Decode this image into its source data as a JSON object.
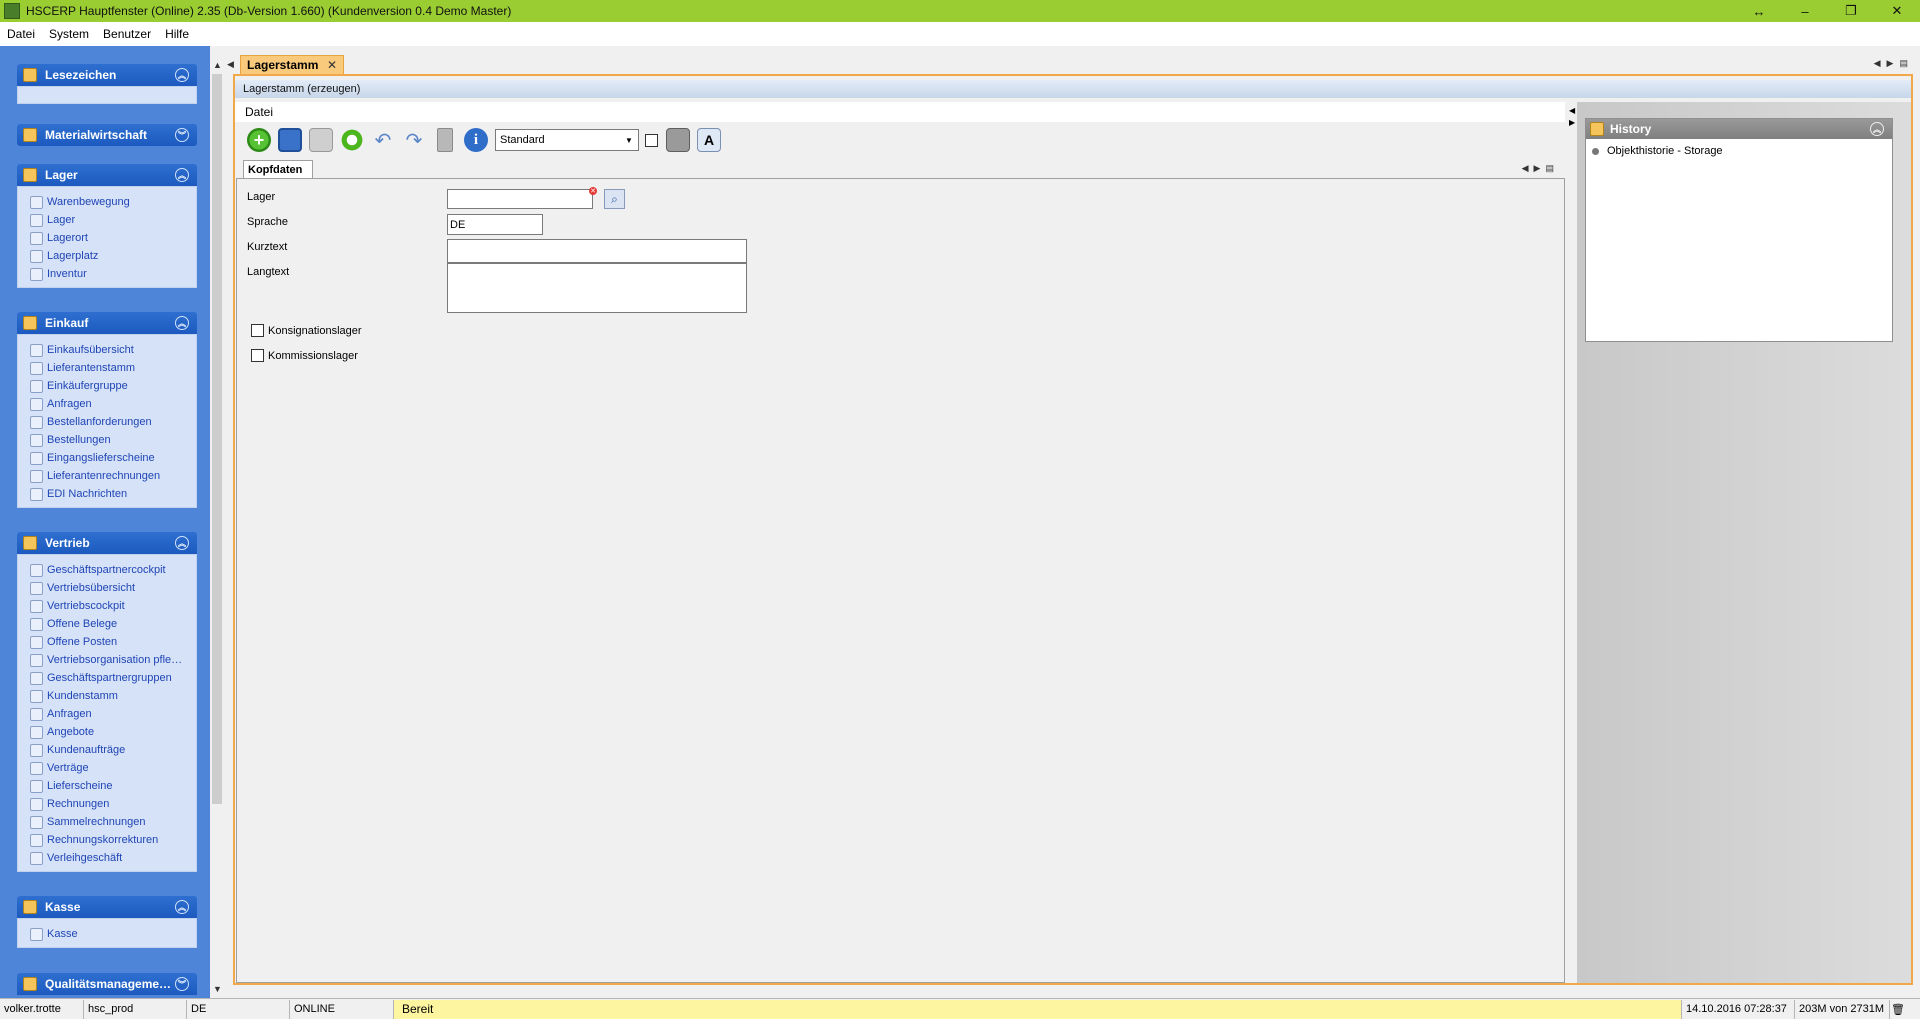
{
  "window": {
    "title": "HSCERP Hauptfenster (Online) 2.35 (Db-Version 1.660) (Kundenversion 0.4 Demo Master)",
    "controls": {
      "restore_move": "↔",
      "minimize": "–",
      "maximize": "❐",
      "close": "✕"
    }
  },
  "menubar": [
    "Datei",
    "System",
    "Benutzer",
    "Hilfe"
  ],
  "sidebar": {
    "sections": [
      {
        "title": "Lesezeichen",
        "items": []
      },
      {
        "title": "Materialwirtschaft",
        "items": []
      },
      {
        "title": "Lager",
        "items": [
          "Warenbewegung",
          "Lager",
          "Lagerort",
          "Lagerplatz",
          "Inventur"
        ]
      },
      {
        "title": "Einkauf",
        "items": [
          "Einkaufsübersicht",
          "Lieferantenstamm",
          "Einkäufergruppe",
          "Anfragen",
          "Bestellanforderungen",
          "Bestellungen",
          "Eingangslieferscheine",
          "Lieferantenrechnungen",
          "EDI Nachrichten"
        ]
      },
      {
        "title": "Vertrieb",
        "items": [
          "Geschäftspartnercockpit",
          "Vertriebsübersicht",
          "Vertriebscockpit",
          "Offene Belege",
          "Offene Posten",
          "Vertriebsorganisation pfle…",
          "Geschäftspartnergruppen",
          "Kundenstamm",
          "Anfragen",
          "Angebote",
          "Kundenaufträge",
          "Verträge",
          "Lieferscheine",
          "Rechnungen",
          "Sammelrechnungen",
          "Rechnungskorrekturen",
          "Verleihgeschäft"
        ]
      },
      {
        "title": "Kasse",
        "items": [
          "Kasse"
        ]
      },
      {
        "title": "Qualitätsmanageme…",
        "items": []
      }
    ]
  },
  "tab": {
    "label": "Lagerstamm",
    "close": "✕"
  },
  "form": {
    "title": "Lagerstamm (erzeugen)",
    "menu": "Datei",
    "toolbar": {
      "view_select": "Standard"
    },
    "subtab": "Kopfdaten",
    "fields": {
      "lager": {
        "label": "Lager",
        "value": ""
      },
      "sprache": {
        "label": "Sprache",
        "value": "DE"
      },
      "kurztext": {
        "label": "Kurztext",
        "value": ""
      },
      "langtext": {
        "label": "Langtext",
        "value": ""
      }
    },
    "checkboxes": {
      "konsignation": "Konsignationslager",
      "kommission": "Kommissionslager"
    }
  },
  "history": {
    "title": "History",
    "items": [
      "Objekthistorie - Storage"
    ]
  },
  "statusbar": {
    "user": "volker.trotte",
    "db": "hsc_prod",
    "lang": "DE",
    "mode": "ONLINE",
    "status": "Bereit",
    "datetime": "14.10.2016 07:28:37",
    "memory": "203M von 2731M"
  },
  "colors": {
    "titlebar": "#9acd32",
    "sidebar_bg": "#4f85d9",
    "section_head": "#1c5abf",
    "tab_active": "#f9c97c",
    "frame_border": "#f0a84a",
    "status_ready": "#fdf5a0"
  }
}
